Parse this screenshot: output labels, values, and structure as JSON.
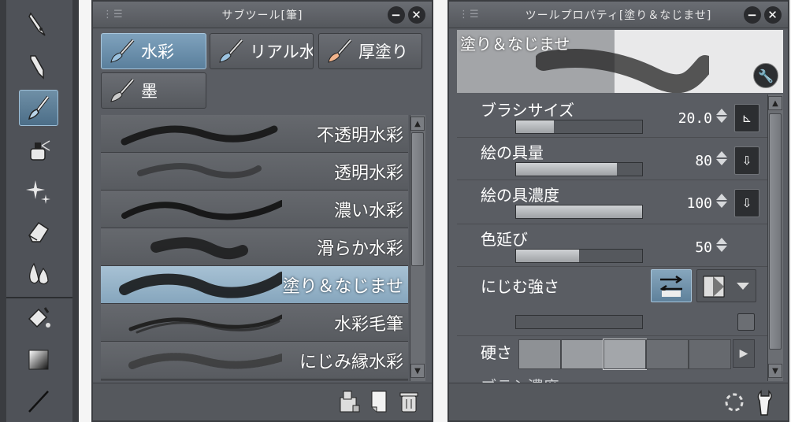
{
  "subtool_panel": {
    "title": "サブツール[筆]",
    "tabs": [
      {
        "label": "水彩",
        "active": true
      },
      {
        "label": "リアル水",
        "active": false
      },
      {
        "label": "厚塗り",
        "active": false
      },
      {
        "label": "墨",
        "active": false
      }
    ],
    "brushes": [
      {
        "name": "不透明水彩",
        "selected": false
      },
      {
        "name": "透明水彩",
        "selected": false
      },
      {
        "name": "濃い水彩",
        "selected": false
      },
      {
        "name": "滑らか水彩",
        "selected": false
      },
      {
        "name": "塗り＆なじませ",
        "selected": true
      },
      {
        "name": "水彩毛筆",
        "selected": false
      },
      {
        "name": "にじみ縁水彩",
        "selected": false
      }
    ]
  },
  "tool_property_panel": {
    "title": "ツールプロパティ[塗り＆なじませ]",
    "preview_title": "塗り＆なじませ",
    "properties": [
      {
        "label": "ブラシサイズ",
        "value": "20.0",
        "level": 0.3
      },
      {
        "label": "絵の具量",
        "value": "80",
        "level": 0.8
      },
      {
        "label": "絵の具濃度",
        "value": "100",
        "level": 1.0
      },
      {
        "label": "色延び",
        "value": "50",
        "level": 0.5
      },
      {
        "label": "にじむ強さ",
        "value": "",
        "level": 0.0
      }
    ],
    "hardness_label": "硬さ",
    "hardness_selected_index": 2,
    "cut_off_label": "ブラシ濃度"
  },
  "colors": {
    "panel_bg": "#5a5d63",
    "accent": "#86a6bd",
    "title_bar": "#606369"
  }
}
